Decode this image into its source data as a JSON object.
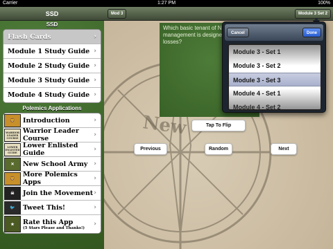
{
  "status_bar": {
    "carrier": "Carrier",
    "time": "1:27 PM",
    "battery": "100%"
  },
  "sidebar": {
    "title": "SSD",
    "section1_title": "SSD",
    "study_items": [
      {
        "label": "Flash Cards",
        "selected": true
      },
      {
        "label": "Module 1 Study Guide"
      },
      {
        "label": "Module 2 Study Guide"
      },
      {
        "label": "Module 3 Study Guide"
      },
      {
        "label": "Module 4 Study Guide"
      }
    ],
    "section2_title": "Polemics Applications",
    "app_items": [
      {
        "label": "Introduction",
        "icon": "lion-icon"
      },
      {
        "label": "Warrior Leader Course",
        "icon": "warrior-leader-course-icon",
        "icon_text": "WARRIOR LEADER COURSE"
      },
      {
        "label": "Lower Enlisted Guide",
        "icon": "lower-enlisted-guide-icon",
        "icon_text": "LOWER ENLISTED GUIDE"
      },
      {
        "label": "New School Army",
        "icon": "army-icon"
      },
      {
        "label": "More Polemics Apps",
        "icon": "lion-icon"
      },
      {
        "label": "Join the Movement",
        "icon": "skull-icon"
      },
      {
        "label": "Tweet This!",
        "icon": "bird-icon"
      },
      {
        "label": "Rate this App",
        "sub": "(5 Stars Please and Thanks!)",
        "icon": "star-icon"
      }
    ]
  },
  "main": {
    "left_button": "Mod 3",
    "right_button": "Module 3 Set 2",
    "card_text": "Which basic tenant of Na... management is designed... Soldier losses?",
    "tap_to_flip": "Tap To Flip",
    "previous": "Previous",
    "random": "Random",
    "next": "Next",
    "compass_text": "New"
  },
  "picker": {
    "cancel": "Cancel",
    "done": "Done",
    "options": [
      "Module 3 - Set 1",
      "Module 3 - Set 2",
      "Module 3 - Set 3",
      "Module 4 - Set 1",
      "Module 4 - Set 2"
    ],
    "selected_index": 2
  },
  "colors": {
    "sidebar_green": "#3f6a2e",
    "accent_blue": "#2a5ed0",
    "card_green": "#3d6a2c"
  }
}
